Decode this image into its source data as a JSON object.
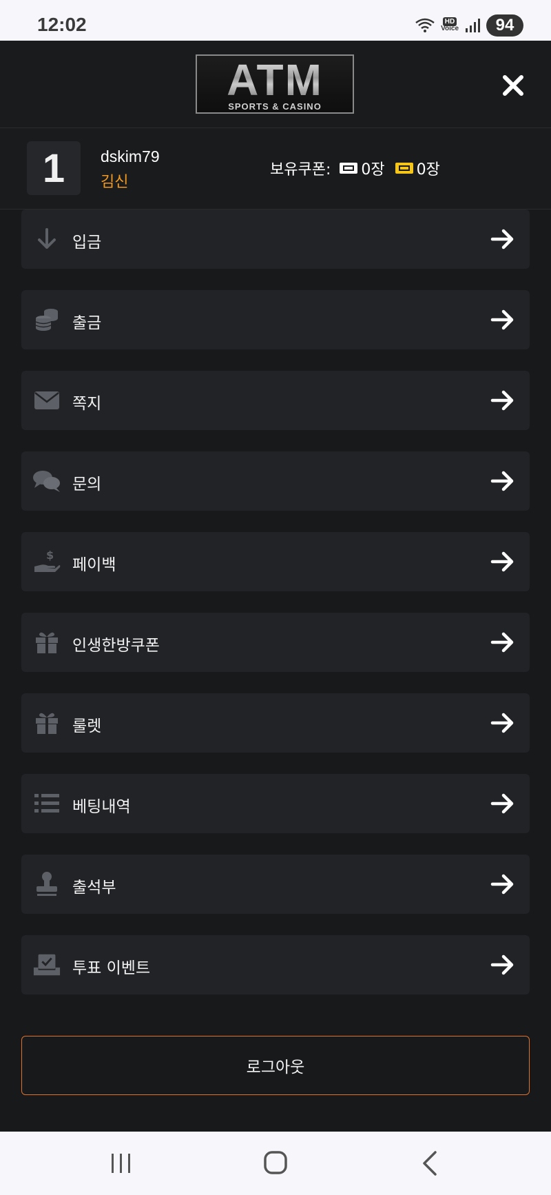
{
  "status_bar": {
    "time": "12:02",
    "hd_label": "HD",
    "voice_label": "Voice",
    "battery": "94"
  },
  "header": {
    "logo_main": "ATM",
    "logo_sub": "SPORTS & CASINO"
  },
  "user": {
    "level": "1",
    "username": "dskim79",
    "grade": "김신",
    "grade_color": "#f29a1f",
    "coupon_label": "보유쿠폰:",
    "coupon_white_count": "0장",
    "coupon_yellow_count": "0장"
  },
  "menu": {
    "items": [
      {
        "label": "입금",
        "icon": "arrow-down-icon"
      },
      {
        "label": "출금",
        "icon": "coins-icon"
      },
      {
        "label": "쪽지",
        "icon": "envelope-icon"
      },
      {
        "label": "문의",
        "icon": "chat-bubbles-icon"
      },
      {
        "label": "페이백",
        "icon": "hand-dollar-icon"
      },
      {
        "label": "인생한방쿠폰",
        "icon": "gift-icon"
      },
      {
        "label": "룰렛",
        "icon": "gift-icon"
      },
      {
        "label": "베팅내역",
        "icon": "list-icon"
      },
      {
        "label": "출석부",
        "icon": "stamp-icon"
      },
      {
        "label": "투표 이벤트",
        "icon": "vote-box-icon"
      }
    ]
  },
  "logout_label": "로그아웃",
  "colors": {
    "background": "#18191b",
    "menu_item": "#222327",
    "accent_orange": "#e0722a",
    "coupon_yellow": "#f5c518"
  }
}
